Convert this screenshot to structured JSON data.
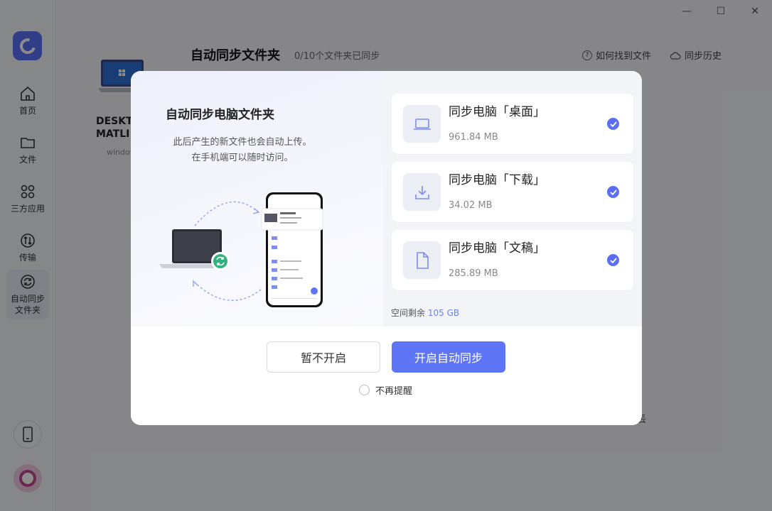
{
  "window": {
    "minimize_glyph": "—",
    "maximize_glyph": "☐",
    "close_glyph": "✕"
  },
  "sidebar": {
    "items": [
      {
        "label": "首页",
        "icon": "home-icon"
      },
      {
        "label": "文件",
        "icon": "folder-icon"
      },
      {
        "label": "三方应用",
        "icon": "apps-icon"
      },
      {
        "label": "传输",
        "icon": "transfer-icon"
      },
      {
        "label": "自动同步\n文件夹",
        "icon": "sync-icon",
        "active": true
      }
    ]
  },
  "header": {
    "title": "自动同步文件夹",
    "count": "0/10个文件夹已同步",
    "help_link": "如何找到文件",
    "history_link": "同步历史"
  },
  "device": {
    "name": "DESKT\nMATLI",
    "os": "window"
  },
  "bg_fragment": "丢",
  "modal": {
    "title": "自动同步电脑文件夹",
    "desc_line1": "此后产生的新文件也会自动上传。",
    "desc_line2": "在手机端可以随时访问。",
    "cards": [
      {
        "name": "同步电脑「桌面」",
        "size": "961.84 MB",
        "icon": "laptop-icon",
        "checked": true
      },
      {
        "name": "同步电脑「下载」",
        "size": "34.02 MB",
        "icon": "download-icon",
        "checked": true
      },
      {
        "name": "同步电脑「文稿」",
        "size": "285.89 MB",
        "icon": "document-icon",
        "checked": true
      }
    ],
    "space_label": "空间剩余",
    "space_value": "105 GB",
    "later_button": "暂不开启",
    "start_button": "开启自动同步",
    "remind_label": "不再提醒"
  },
  "colors": {
    "accent": "#5e75f7",
    "accent_text": "#6a82f2"
  }
}
